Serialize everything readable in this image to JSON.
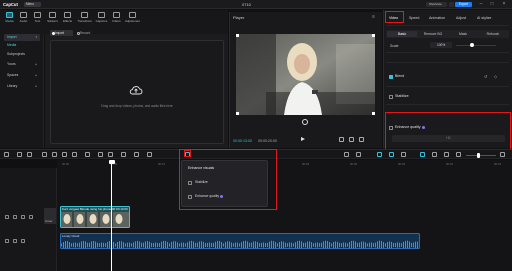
{
  "app": {
    "logo": "CapCut",
    "menu_label": "Menu",
    "title": "0710",
    "shortcut_label": "Shortcuts",
    "export_label": "Export",
    "accent": "#39c1d6",
    "highlight_color": "#e0191b"
  },
  "toolbar": {
    "items": [
      {
        "label": "Media",
        "icon": "media-icon"
      },
      {
        "label": "Audio",
        "icon": "audio-icon"
      },
      {
        "label": "Text",
        "icon": "text-icon"
      },
      {
        "label": "Stickers",
        "icon": "sticker-icon"
      },
      {
        "label": "Effects",
        "icon": "effects-icon"
      },
      {
        "label": "Transitions",
        "icon": "transitions-icon"
      },
      {
        "label": "Captions",
        "icon": "captions-icon"
      },
      {
        "label": "Filters",
        "icon": "filters-icon"
      },
      {
        "label": "Adjustment",
        "icon": "adjustment-icon"
      }
    ]
  },
  "sidebar": {
    "items": [
      {
        "label": "Import",
        "has_chevron": true
      },
      {
        "label": "Media",
        "has_chevron": false
      },
      {
        "label": "Subprojects",
        "has_chevron": false
      },
      {
        "label": "Yours",
        "has_chevron": true
      },
      {
        "label": "Spaces",
        "has_chevron": true
      },
      {
        "label": "Library",
        "has_chevron": true
      }
    ]
  },
  "media": {
    "import_label": "Import",
    "record_label": "Record",
    "drop_text": "Drag and drop videos, photos, and audio files here"
  },
  "player": {
    "label": "Player",
    "time_current": "00:00:13:00",
    "time_total": "00:00:20:00"
  },
  "right_panel": {
    "tabs": [
      "Video",
      "Speed",
      "Animation",
      "Adjust",
      "AI stylize"
    ],
    "subtabs": [
      "Basic",
      "Remove BG",
      "Mask",
      "Retouch"
    ],
    "scale_label": "Scale",
    "scale_value": "100%",
    "blend_label": "Blend",
    "stabilize_label": "Stabilize",
    "enhance_label": "Enhance quality",
    "enhance_dropdown": "HD"
  },
  "timeline": {
    "ticks": [
      "00:00",
      "00:05",
      "00:10",
      "00:15",
      "00:20",
      "00:25",
      "00:30",
      "00:35",
      "00:40",
      "00:45"
    ],
    "video_clip_label": "Kurz vorgeet Blonde using his phone  00:00:10:00",
    "audio_clip_label": "Lovely Cloud",
    "cover_label": "Cover"
  },
  "popup": {
    "title": "Enhance visuals",
    "options": [
      "Stabilize",
      "Enhance quality"
    ]
  }
}
